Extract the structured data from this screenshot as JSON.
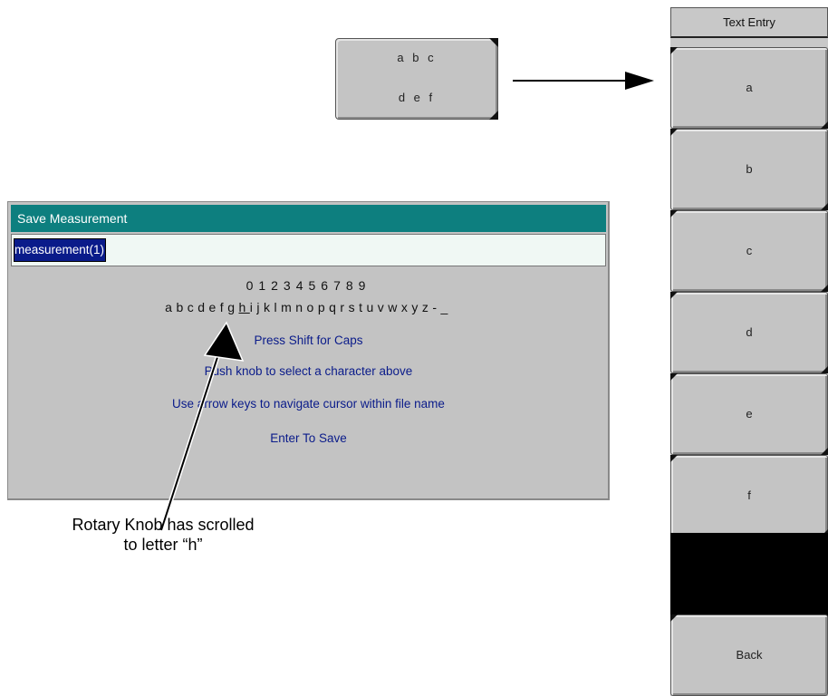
{
  "softkey": {
    "line1": "a b c",
    "line2": "d e f"
  },
  "menu": {
    "title": "Text Entry",
    "items": [
      "a",
      "b",
      "c",
      "d",
      "e",
      "f"
    ],
    "back_label": "Back"
  },
  "dialog": {
    "title": "Save Measurement",
    "input_value": "measurement(1)",
    "digits": "0123456789",
    "letters_before": "abcdefg",
    "letter_highlight": "h",
    "letters_after": "ijklmnopqrstuvwxyz-_",
    "instruction_caps": "Press Shift for Caps",
    "instruction_knob": "Push knob to select a character above",
    "instruction_arrows": "Use arrow keys to navigate cursor within file name",
    "instruction_enter": "Enter To Save"
  },
  "annotation": {
    "line1": "Rotary Knob has scrolled",
    "line2": "to letter “h”"
  },
  "colors": {
    "title_bar": "#0d7f7f",
    "selection": "#0a1b8a",
    "instruction_text": "#0a1b8a",
    "panel": "#c3c3c3"
  }
}
